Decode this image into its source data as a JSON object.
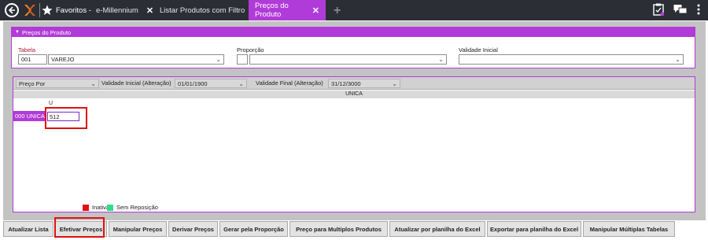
{
  "topbar": {
    "favorites_label": "Favoritos -",
    "tabs": [
      {
        "label": "e-Millennium"
      },
      {
        "label": "Listar Produtos com Filtro"
      },
      {
        "label": "Preços do Produto"
      }
    ]
  },
  "panel1": {
    "title": "Preços do Produto",
    "tabela_label": "Tabela",
    "tabela_code": "001",
    "tabela_value": "VAREJO",
    "proporcao_label": "Proporção",
    "proporcao_code": "",
    "proporcao_value": "",
    "validade_label": "Validade Inicial",
    "validade_value": ""
  },
  "filters": {
    "preco_por": "Preço Por",
    "validade_inicial_label": "Validade Inicial (Alteração)",
    "validade_inicial_value": "01/01/1900",
    "validade_final_label": "Validade Final (Alteração)",
    "validade_final_value": "31/12/3000"
  },
  "grid": {
    "column_header": "UNICA",
    "sub_column": "U",
    "row_label": "000 UNICA",
    "cell_value": "512"
  },
  "legend": {
    "inativa": "Inativa",
    "sem_reposicao": "Sem Reposição",
    "inativa_color": "#e01010",
    "sem_reposicao_color": "#33dd88"
  },
  "buttons": [
    {
      "label": "Atualizar Lista"
    },
    {
      "label": "Efetivar Preços"
    },
    {
      "label": "Manipular Preços"
    },
    {
      "label": "Derivar Preços"
    },
    {
      "label": "Gerar pela Proporção"
    },
    {
      "label": "Preço para Multiplos Produtos"
    },
    {
      "label": "Atualizar por planilha do Excel"
    },
    {
      "label": "Exportar para planilha do Excel"
    },
    {
      "label": "Manipular Múltiplas Tabelas"
    }
  ],
  "colors": {
    "accent": "#b13bd8",
    "topbar": "#2b2f35",
    "highlight": "#e01010"
  }
}
